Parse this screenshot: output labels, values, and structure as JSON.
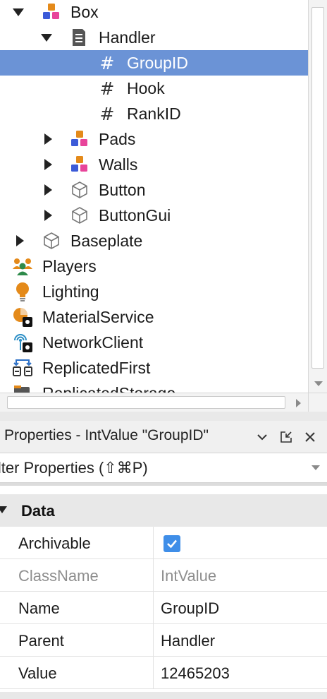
{
  "explorer": {
    "items": [
      {
        "label": "Box",
        "icon": "model-icon",
        "indent": 0,
        "arrow": "down",
        "selected": false
      },
      {
        "label": "Handler",
        "icon": "script-icon",
        "indent": 1,
        "arrow": "down",
        "selected": false
      },
      {
        "label": "GroupID",
        "icon": "hash-icon",
        "indent": 2,
        "arrow": "none",
        "selected": true
      },
      {
        "label": "Hook",
        "icon": "hash-icon",
        "indent": 2,
        "arrow": "none",
        "selected": false
      },
      {
        "label": "RankID",
        "icon": "hash-icon",
        "indent": 2,
        "arrow": "none",
        "selected": false
      },
      {
        "label": "Pads",
        "icon": "model-icon",
        "indent": 1,
        "arrow": "right",
        "selected": false
      },
      {
        "label": "Walls",
        "icon": "model-icon",
        "indent": 1,
        "arrow": "right",
        "selected": false
      },
      {
        "label": "Button",
        "icon": "part-icon",
        "indent": 1,
        "arrow": "right",
        "selected": false
      },
      {
        "label": "ButtonGui",
        "icon": "part-icon",
        "indent": 1,
        "arrow": "right",
        "selected": false
      },
      {
        "label": "Baseplate",
        "icon": "part-icon",
        "indent": 0,
        "arrow": "right",
        "selected": false
      },
      {
        "label": "Players",
        "icon": "players-icon",
        "indent": -1,
        "arrow": "none",
        "selected": false
      },
      {
        "label": "Lighting",
        "icon": "lightbulb-icon",
        "indent": -1,
        "arrow": "none",
        "selected": false
      },
      {
        "label": "MaterialService",
        "icon": "material-service-icon",
        "indent": -1,
        "arrow": "none",
        "selected": false
      },
      {
        "label": "NetworkClient",
        "icon": "network-client-icon",
        "indent": -1,
        "arrow": "none",
        "selected": false
      },
      {
        "label": "ReplicatedFirst",
        "icon": "replicated-first-icon",
        "indent": -1,
        "arrow": "none",
        "selected": false
      },
      {
        "label": "ReplicatedStorage",
        "icon": "replicated-storage-icon",
        "indent": -1,
        "arrow": "none",
        "selected": false
      }
    ]
  },
  "properties": {
    "title": "Properties - IntValue \"GroupID\"",
    "filter_placeholder": "ilter Properties (⇧⌘P)",
    "section": "Data",
    "rows": [
      {
        "name": "Archivable",
        "value": "",
        "checkbox": true,
        "checked": true,
        "dim": false
      },
      {
        "name": "ClassName",
        "value": "IntValue",
        "checkbox": false,
        "dim": true
      },
      {
        "name": "Name",
        "value": "GroupID",
        "checkbox": false,
        "dim": false
      },
      {
        "name": "Parent",
        "value": "Handler",
        "checkbox": false,
        "dim": false
      },
      {
        "name": "Value",
        "value": "12465203",
        "checkbox": false,
        "dim": false
      }
    ]
  },
  "colors": {
    "selection": "#6b93d6",
    "checkbox": "#3f8ee8",
    "section_bg": "#e8e8e8"
  }
}
